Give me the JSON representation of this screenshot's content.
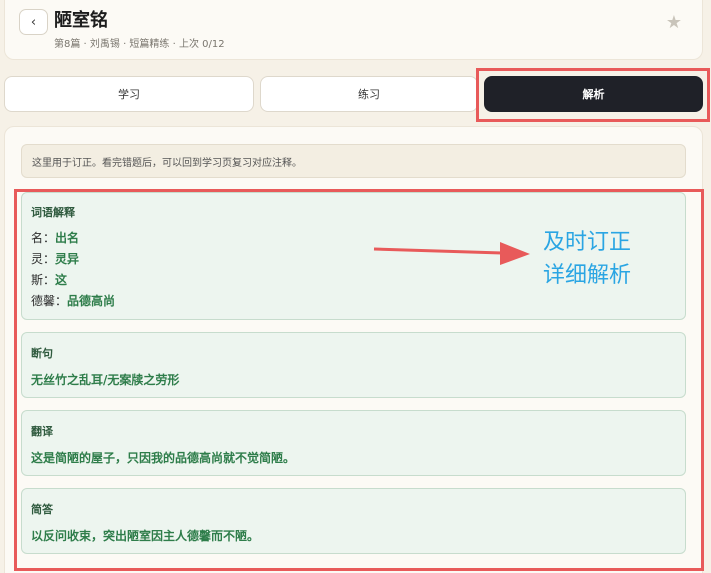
{
  "header": {
    "back_label": "‹",
    "title": "陋室铭",
    "subtitle": "第8篇 · 刘禹锡 · 短篇精练 · 上次 0/12",
    "star_icon": "star-icon"
  },
  "tabs": [
    {
      "label": "学习",
      "active": false
    },
    {
      "label": "练习",
      "active": false
    },
    {
      "label": "解析",
      "active": true
    }
  ],
  "notice": "这里用于订正。看完错题后，可以回到学习页复习对应注释。",
  "vocab": {
    "title": "词语解释",
    "items": [
      {
        "term": "名：",
        "meaning": "出名"
      },
      {
        "term": "灵：",
        "meaning": "灵异"
      },
      {
        "term": "斯：",
        "meaning": "这"
      },
      {
        "term": "德馨：",
        "meaning": "品德高尚"
      }
    ]
  },
  "sentence_break": {
    "title": "断句",
    "text": "无丝竹之乱耳/无案牍之劳形"
  },
  "translation": {
    "title": "翻译",
    "text": "这是简陋的屋子，只因我的品德高尚就不觉简陋。"
  },
  "short_answer": {
    "title": "简答",
    "text": "以反问收束，突出陋室因主人德馨而不陋。"
  },
  "annotation": {
    "line1": "及时订正",
    "line2": "详细解析"
  },
  "colors": {
    "highlight": "#e85a5a",
    "annotation": "#2aa5e3",
    "accent_green": "#2e7d4a",
    "active_tab": "#1f2128"
  }
}
